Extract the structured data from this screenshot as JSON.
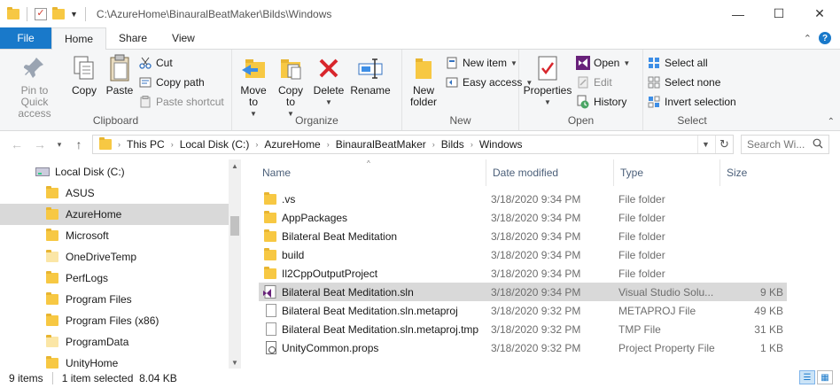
{
  "window": {
    "title_path": "C:\\AzureHome\\BinauralBeatMaker\\Bilds\\Windows",
    "controls": {
      "minimize": "—",
      "maximize": "☐",
      "close": "✕"
    }
  },
  "tabs": [
    {
      "label": "File"
    },
    {
      "label": "Home"
    },
    {
      "label": "Share"
    },
    {
      "label": "View"
    }
  ],
  "ribbon": {
    "clipboard": {
      "label": "Clipboard",
      "pin": "Pin to Quick access",
      "copy": "Copy",
      "paste": "Paste",
      "cut": "Cut",
      "copy_path": "Copy path",
      "paste_shortcut": "Paste shortcut"
    },
    "organize": {
      "label": "Organize",
      "move_to": "Move to",
      "copy_to": "Copy to",
      "delete": "Delete",
      "rename": "Rename"
    },
    "new": {
      "label": "New",
      "new_folder": "New folder",
      "new_item": "New item",
      "easy_access": "Easy access"
    },
    "open": {
      "label": "Open",
      "properties": "Properties",
      "open": "Open",
      "edit": "Edit",
      "history": "History"
    },
    "select": {
      "label": "Select",
      "select_all": "Select all",
      "select_none": "Select none",
      "invert_selection": "Invert selection"
    }
  },
  "address": {
    "crumbs": [
      "This PC",
      "Local Disk (C:)",
      "AzureHome",
      "BinauralBeatMaker",
      "Bilds",
      "Windows"
    ],
    "search_placeholder": "Search Wi..."
  },
  "nav": {
    "items": [
      {
        "label": "Local Disk (C:)",
        "type": "drive"
      },
      {
        "label": "ASUS",
        "type": "folder"
      },
      {
        "label": "AzureHome",
        "type": "folder",
        "selected": true
      },
      {
        "label": "Microsoft",
        "type": "folder"
      },
      {
        "label": "OneDriveTemp",
        "type": "folder-light"
      },
      {
        "label": "PerfLogs",
        "type": "folder"
      },
      {
        "label": "Program Files",
        "type": "folder"
      },
      {
        "label": "Program Files (x86)",
        "type": "folder"
      },
      {
        "label": "ProgramData",
        "type": "folder-light"
      },
      {
        "label": "UnityHome",
        "type": "folder"
      }
    ]
  },
  "columns": {
    "name": "Name",
    "date": "Date modified",
    "type": "Type",
    "size": "Size"
  },
  "files": [
    {
      "name": ".vs",
      "date": "3/18/2020 9:34 PM",
      "type": "File folder",
      "size": "",
      "icon": "folder"
    },
    {
      "name": "AppPackages",
      "date": "3/18/2020 9:34 PM",
      "type": "File folder",
      "size": "",
      "icon": "folder"
    },
    {
      "name": "Bilateral Beat Meditation",
      "date": "3/18/2020 9:34 PM",
      "type": "File folder",
      "size": "",
      "icon": "folder"
    },
    {
      "name": "build",
      "date": "3/18/2020 9:34 PM",
      "type": "File folder",
      "size": "",
      "icon": "folder"
    },
    {
      "name": "Il2CppOutputProject",
      "date": "3/18/2020 9:34 PM",
      "type": "File folder",
      "size": "",
      "icon": "folder"
    },
    {
      "name": "Bilateral Beat Meditation.sln",
      "date": "3/18/2020 9:34 PM",
      "type": "Visual Studio Solu...",
      "size": "9 KB",
      "icon": "sln",
      "selected": true
    },
    {
      "name": "Bilateral Beat Meditation.sln.metaproj",
      "date": "3/18/2020 9:32 PM",
      "type": "METAPROJ File",
      "size": "49 KB",
      "icon": "file"
    },
    {
      "name": "Bilateral Beat Meditation.sln.metaproj.tmp",
      "date": "3/18/2020 9:32 PM",
      "type": "TMP File",
      "size": "31 KB",
      "icon": "file"
    },
    {
      "name": "UnityCommon.props",
      "date": "3/18/2020 9:32 PM",
      "type": "Project Property File",
      "size": "1 KB",
      "icon": "props"
    }
  ],
  "status": {
    "count": "9 items",
    "selection": "1 item selected  8.04 KB"
  },
  "colors": {
    "accent": "#1979ca",
    "selection": "#d9d9d9",
    "folder": "#f7c843"
  }
}
